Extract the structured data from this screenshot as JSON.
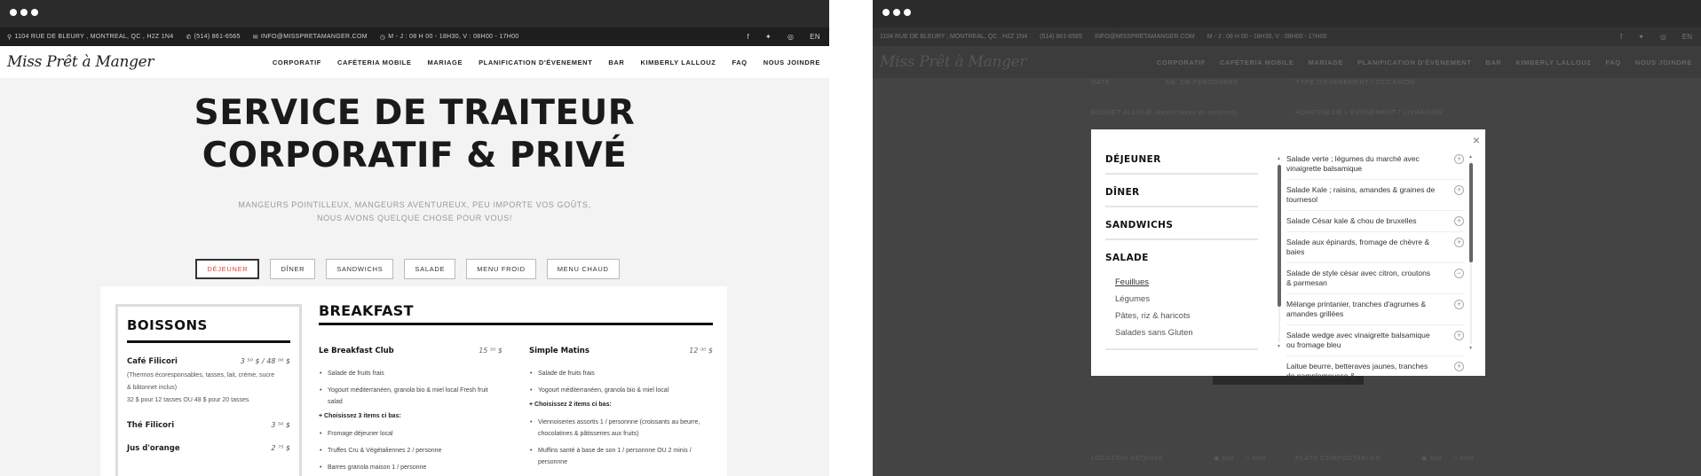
{
  "site": {
    "address": "1104 RUE DE BLEURY , MONTREAL, QC , H2Z 1N4",
    "phone": "(514) 861-6565",
    "email": "INFO@MISSPRETAMANGER.COM",
    "hours": "M - J : 08 H 00 - 18H30, V : 08H00 - 17H00",
    "lang": "EN",
    "logo": "Miss Prêt à Manger",
    "nav": [
      "CORPORATIF",
      "CAFÉTERIA MOBILE",
      "MARIAGE",
      "PLANIFICATION D'ÉVENEMENT",
      "BAR",
      "KIMBERLY LALLOUZ",
      "FAQ",
      "NOUS JOINDRE"
    ]
  },
  "icons": {
    "pin": "map-pin-icon",
    "phone": "phone-icon",
    "email": "envelope-icon",
    "clock": "clock-icon",
    "facebook": "facebook-icon",
    "twitter": "twitter-icon",
    "instagram": "instagram-icon"
  },
  "hero": {
    "title_line1": "SERVICE DE TRAITEUR",
    "title_line2": "CORPORATIF & PRIVÉ",
    "sub_line1": "MANGEURS POINTILLEUX, MANGEURS AVENTUREUX, PEU IMPORTE VOS GOÛTS,",
    "sub_line2": "NOUS AVONS QUELQUE CHOSE POUR VOUS!"
  },
  "tabs": [
    "DÉJEUNER",
    "DÎNER",
    "SANDWICHS",
    "SALADE",
    "MENU FROID",
    "MENU CHAUD"
  ],
  "boissons": {
    "title": "BOISSONS",
    "items": [
      {
        "name": "Café Filicori",
        "price": "3 ⁵⁰ $ / 48 ⁰⁰ $",
        "desc1": "(Thermos écoresponsables, tasses, lait, crème, sucre",
        "desc2": "& bâtonnet inclus)",
        "desc3": "32 $ pour 12 tasses OU 48 $ pour 20 tasses"
      },
      {
        "name": "Thé Filicori",
        "price": "3 ⁵⁰ $"
      },
      {
        "name": "Jus d'orange",
        "price": "2 ⁷⁵ $"
      }
    ]
  },
  "breakfast": {
    "title": "BREAKFAST",
    "col1": {
      "name": "Le Breakfast Club",
      "price": "15 ⁵⁰ $",
      "items": [
        "Salade de fruits frais",
        "Yogourt méditerranéen, granola bio & miel local Fresh fruit salad"
      ],
      "choose": "+ Choisissez 3 items ci bas:",
      "extras": [
        "Fromage déjeuner local",
        "Truffes Cru & Végétaliennes 2 / personne",
        "Barres granola maison 1 / personne"
      ]
    },
    "col2": {
      "name": "Simple Matins",
      "price": "12 ⁰⁰ $",
      "items": [
        "Salade de fruits frais",
        "Yogourt méditerranéen, granola bio & miel local"
      ],
      "choose": "+ Choisissez 2 items ci bas:",
      "extras": [
        "Viennoiseries assortis 1 / personnne (croissants au beurre, chocolatines & pâtisseries aux fruits)",
        "Muffins santé à base de son 1 / personnne OU 2 minis / personnne"
      ]
    }
  },
  "bg_form": {
    "date": "DATE",
    "people": "NB. DE PERSONNES",
    "event_type": "TYPE D'ÉVENEMENT / OCCASION",
    "budget": "BUDGET ALLOUÉ (avant taxes et services)",
    "address": "ADRESSE DE L'ÉVENEMENT / LIVRAISON",
    "location": "LOCATION REQUISE",
    "plates": "PLATS COMPOSTABLES",
    "yes": "Oui",
    "no": "Non"
  },
  "modal": {
    "close": "×",
    "categories": [
      "DÉJEUNER",
      "DÎNER",
      "SANDWICHS",
      "SALADE"
    ],
    "subcategories": [
      "Feuillues",
      "Légumes",
      "Pâtes, riz & haricots",
      "Salades sans Gluten"
    ],
    "salads": [
      {
        "text": "Salade verte ; légumes du marché avec vinaigrette balsamique",
        "sign": "+"
      },
      {
        "text": "Salade Kale ; raisins, amandes & graines de tournesol",
        "sign": "+"
      },
      {
        "text": "Salade César kale & chou de bruxelles",
        "sign": "+"
      },
      {
        "text": "Salade aux épinards, fromage de chèvre & baies",
        "sign": "+"
      },
      {
        "text": "Salade de style césar avec citron, croutons & parmesan",
        "sign": "−"
      },
      {
        "text": "Mélange printanier, tranches d'agrumes & amandes grillées",
        "sign": "+"
      },
      {
        "text": "Salade wedge avec vinaigrette balsamique ou fromage bleu",
        "sign": "+"
      },
      {
        "text": "Laitue beurre, betteraves jaunes, tranches de pamplemousse &",
        "sign": "+"
      }
    ]
  }
}
